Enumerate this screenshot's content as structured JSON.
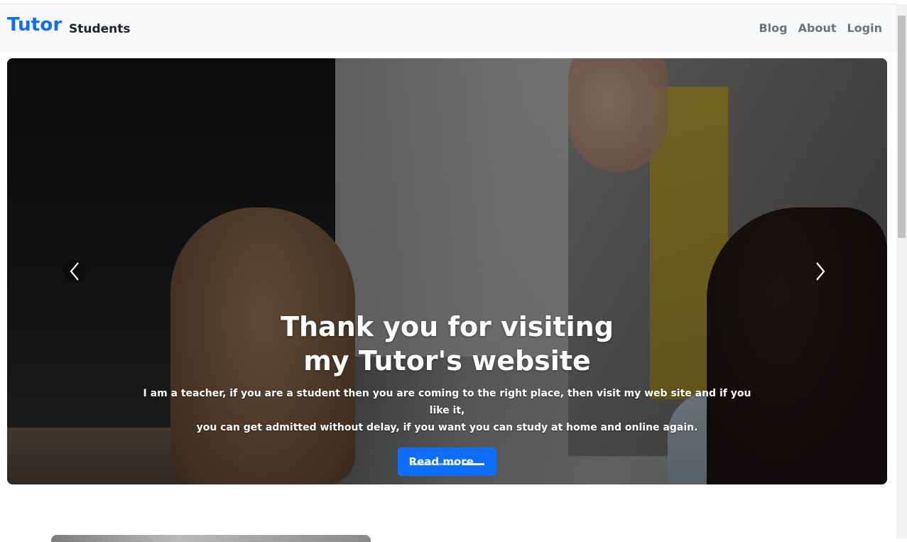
{
  "navbar": {
    "brand": "Tutor",
    "brand_sub": "Students",
    "links": [
      "Blog",
      "About",
      "Login"
    ]
  },
  "hero": {
    "title_line1": "Thank you for visiting",
    "title_line2": "my Tutor's website",
    "text_line1": "I am a teacher, if you are a student then you are coming to the right place, then visit my web site and if you like it,",
    "text_line2": "you can get admitted without delay, if you want you can study at home and online again.",
    "button": "Read more ..",
    "slides_count": 3,
    "active_slide": 3
  },
  "colors": {
    "brand": "#0d6efd",
    "nav_bg": "#f8f9fa",
    "button": "#0d6efd"
  },
  "icons": {
    "prev": "chevron-left-icon",
    "next": "chevron-right-icon"
  }
}
